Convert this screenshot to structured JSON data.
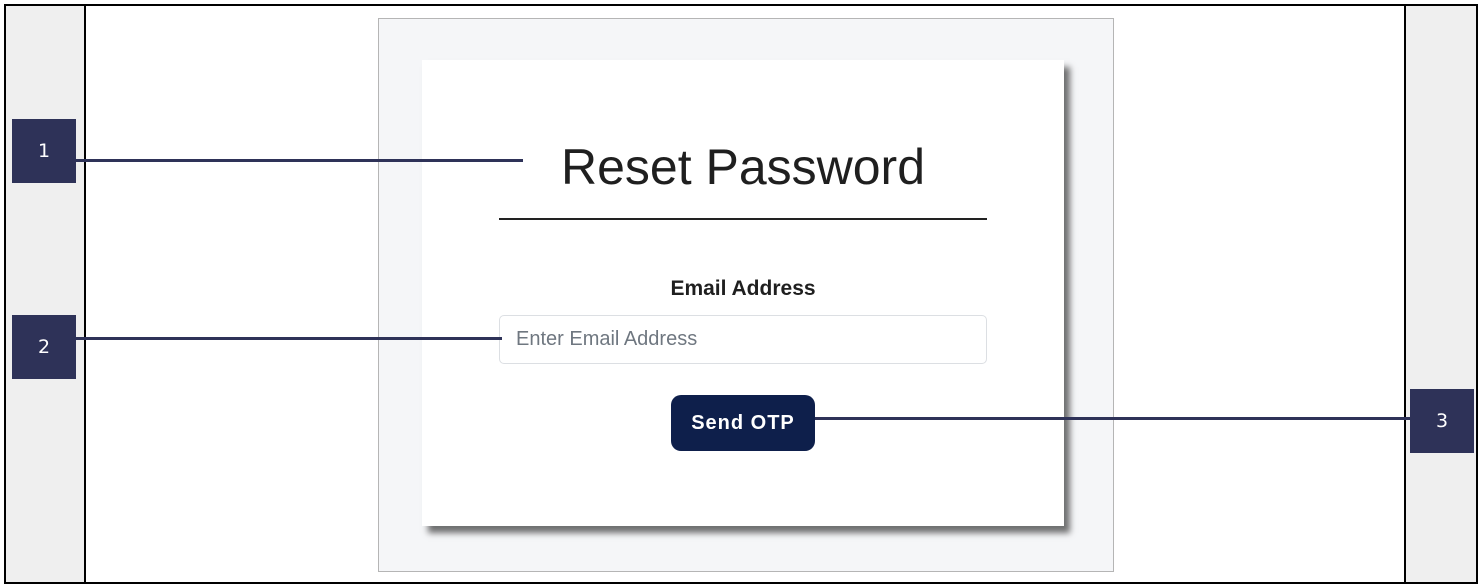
{
  "form": {
    "title": "Reset Password",
    "email_label": "Email Address",
    "email_placeholder": "Enter Email Address",
    "email_value": "",
    "send_button_label": "Send OTP"
  },
  "callouts": [
    "1",
    "2",
    "3"
  ],
  "colors": {
    "button_bg": "#0e1f4b",
    "callout_bg": "#2e3258",
    "panel_bg": "#f5f6f8"
  }
}
